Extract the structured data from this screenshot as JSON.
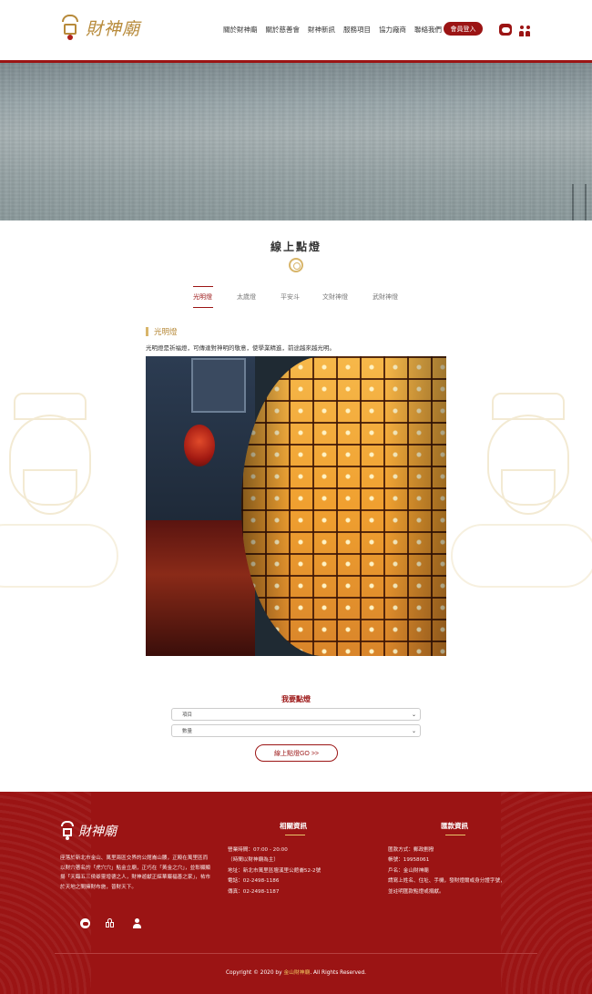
{
  "header": {
    "logo_text": "財神廟",
    "nav": [
      "關於財神廟",
      "關於慈善會",
      "財神新訊",
      "服務項目",
      "協力廠商",
      "聯絡我們"
    ],
    "login_label": "會員登入",
    "icons": [
      "line-icon",
      "people-icon"
    ],
    "accent_color": "#9b1414"
  },
  "section": {
    "title": "線上點燈",
    "tabs": [
      "光明燈",
      "太歲燈",
      "平安斗",
      "文財神燈",
      "武財神燈"
    ],
    "active_tab": "光明燈"
  },
  "content": {
    "heading": "光明燈",
    "description": "光明燈是祈福燈，可傳達對神明的敬意，使學業精進，前途越來越光明。"
  },
  "form": {
    "title": "我要點燈",
    "select_item": "項目",
    "select_qty": "數量",
    "submit_label": "線上點燈GO >>"
  },
  "footer": {
    "logo_text": "財神廟",
    "about": "座落於新北市金山、萬里兩區交界的公館崙山腰，正殿在萬里區而以財穴著名的「虎穴穴」點金立廟，正巧在「黃金之穴」，並彰顯顯揚「天臨五三侯爺靈增德之人，財神遊獻正綵華巖福善之家」，祐市於天地之間擁財布施，普財天下。",
    "contact": {
      "title": "相關資訊",
      "lines": [
        "營業時間：07:00 - 20:00",
        "（時間以財神廟為主）",
        "地址：新北市萬里區壇溪里公館崙52-2號",
        "電話：02-2498-1186",
        "傳真：02-2498-1187"
      ]
    },
    "remit": {
      "title": "匯款資訊",
      "lines": [
        "匯款方式：郵政劃撥",
        "帳號：19958061",
        "戶名：金山財神廟",
        "請寫上姓名、住址、手機，發財燈爾或身分證字號，",
        "並註明匯款點燈或捐獻。"
      ]
    },
    "copyright_pre": "Copyright © 2020 by ",
    "copyright_hl": "金山財神廟",
    "copyright_post": ". All Rights Reserved."
  }
}
